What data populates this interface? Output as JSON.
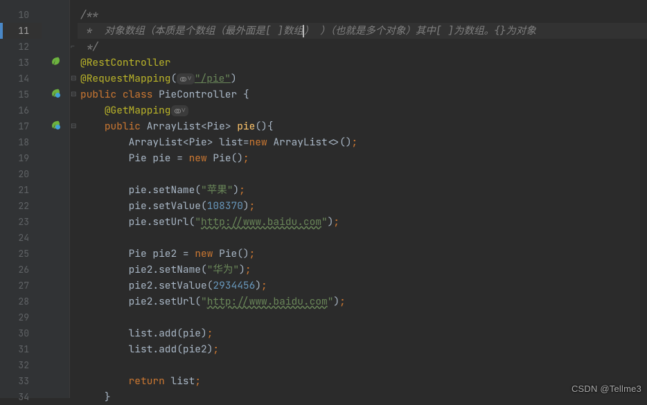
{
  "lines": [
    {
      "n": "10"
    },
    {
      "n": "11",
      "active": true
    },
    {
      "n": "12"
    },
    {
      "n": "13"
    },
    {
      "n": "14"
    },
    {
      "n": "15"
    },
    {
      "n": "16"
    },
    {
      "n": "17"
    },
    {
      "n": "18"
    },
    {
      "n": "19"
    },
    {
      "n": "20"
    },
    {
      "n": "21"
    },
    {
      "n": "22"
    },
    {
      "n": "23"
    },
    {
      "n": "24"
    },
    {
      "n": "25"
    },
    {
      "n": "26"
    },
    {
      "n": "27"
    },
    {
      "n": "28"
    },
    {
      "n": "29"
    },
    {
      "n": "30"
    },
    {
      "n": "31"
    },
    {
      "n": "32"
    },
    {
      "n": "33"
    },
    {
      "n": "34"
    }
  ],
  "code": {
    "l10": "/**",
    "l11a": " *  对象数组（本质是个数组（最外面是[ ]数组",
    "l11b": "） ）（也就是多个对象）其中[ ]为数组。{}为对象",
    "l12": " */",
    "l13": "@RestController",
    "l14a": "@RequestMapping",
    "l14b": "(",
    "l14path": "\"/pie\"",
    "l14c": ")",
    "l15a": "public ",
    "l15b": "class ",
    "l15c": "PieController {",
    "l16a": "@GetMapping",
    "l17a": "public ",
    "l17b": "ArrayList<Pie> ",
    "l17c": "pie",
    "l17d": "(){",
    "l18a": "ArrayList<Pie> list=",
    "l18b": "new ",
    "l18c": "ArrayList<>()",
    "l18d": ";",
    "l19a": "Pie pie = ",
    "l19b": "new ",
    "l19c": "Pie()",
    "l19d": ";",
    "l21a": "pie.setName(",
    "l21b": "\"苹果\"",
    "l21c": ")",
    "l21d": ";",
    "l22a": "pie.setValue(",
    "l22b": "108370",
    "l22c": ")",
    "l22d": ";",
    "l23a": "pie.setUrl(",
    "l23b": "\"",
    "l23c": "http://www.baidu.com",
    "l23d": "\"",
    "l23e": ")",
    "l23f": ";",
    "l25a": "Pie pie2 = ",
    "l25b": "new ",
    "l25c": "Pie()",
    "l25d": ";",
    "l26a": "pie2.setName(",
    "l26b": "\"华为\"",
    "l26c": ")",
    "l26d": ";",
    "l27a": "pie2.setValue(",
    "l27b": "2934456",
    "l27c": ")",
    "l27d": ";",
    "l28a": "pie2.setUrl(",
    "l28b": "\"",
    "l28c": "http://www.baidu.com",
    "l28d": "\"",
    "l28e": ")",
    "l28f": ";",
    "l30a": "list.add(pie)",
    "l30b": ";",
    "l31a": "list.add(pie2)",
    "l31b": ";",
    "l33a": "return ",
    "l33b": "list",
    "l33c": ";",
    "l34": "}"
  },
  "watermark": "CSDN @Tellme3"
}
